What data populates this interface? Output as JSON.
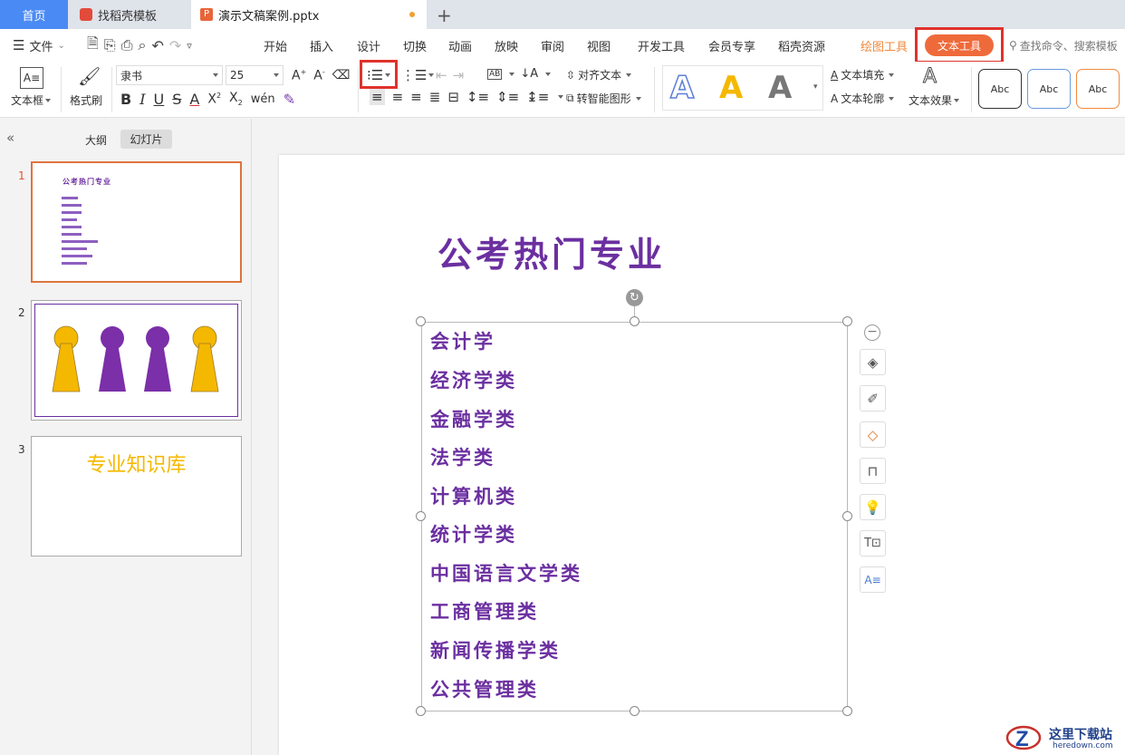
{
  "tabs": {
    "home": "首页",
    "templates": "找稻壳模板",
    "document": "演示文稿案例.pptx"
  },
  "menu": {
    "file": "文件",
    "items": [
      "开始",
      "插入",
      "设计",
      "切换",
      "动画",
      "放映",
      "审阅",
      "视图",
      "开发工具",
      "会员专享",
      "稻壳资源"
    ],
    "drawing_tools": "绘图工具",
    "text_tools": "文本工具",
    "search_placeholder": "查找命令、搜索模板"
  },
  "ribbon": {
    "textbox": "文本框",
    "format_painter": "格式刷",
    "font_name": "隶书",
    "font_size": "25",
    "align_text": "对齐文本",
    "smart_shape": "转智能图形",
    "text_fill": "文本填充",
    "text_outline": "文本轮廓",
    "text_effect": "文本效果",
    "style_samples": [
      "Abc",
      "Abc",
      "Abc"
    ],
    "wordart_glyph": "A"
  },
  "panel": {
    "outline_tab": "大纲",
    "slides_tab": "幻灯片",
    "slide_numbers": [
      "1",
      "2",
      "3"
    ],
    "slide3_title": "专业知识库"
  },
  "slide": {
    "title": "公考热门专业",
    "items": [
      "会计学",
      "经济学类",
      "金融学类",
      "法学类",
      "计算机类",
      "统计学类",
      "中国语言文学类",
      "工商管理类",
      "新闻传播学类",
      "公共管理类"
    ]
  },
  "watermark": {
    "name": "这里下载站",
    "url": "heredown.com"
  },
  "colors": {
    "accent_blue": "#4a8af4",
    "title_purple": "#6b2fa0",
    "orange": "#f08a3e",
    "highlight_red": "#e0322c"
  }
}
